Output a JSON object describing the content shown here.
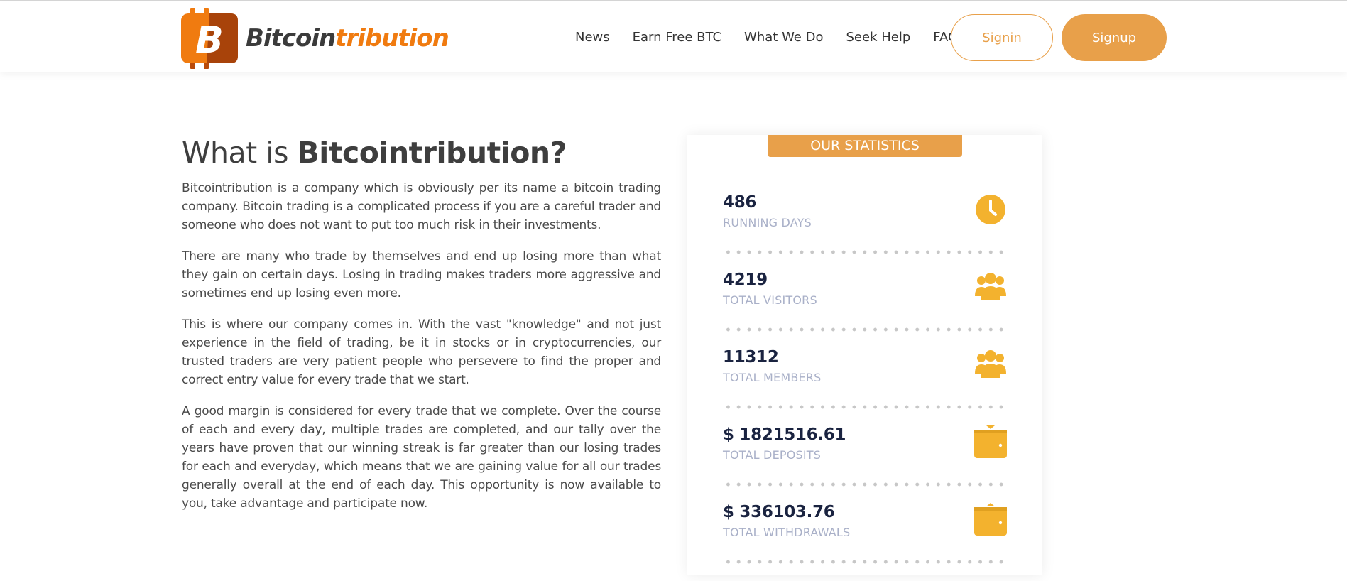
{
  "brand": {
    "name_dark": "Bitcoin",
    "name_orange": "tribution",
    "logo_letter": "B",
    "colors": {
      "accent": "#e8a04a",
      "logo_orange": "#f07b10",
      "icon_yellow": "#f3b22e",
      "heading": "#3e3e3e"
    }
  },
  "nav": {
    "items": [
      "News",
      "Earn Free BTC",
      "What We Do",
      "Seek Help",
      "FAQ"
    ],
    "signin_label": "Signin",
    "signup_label": "Signup"
  },
  "about": {
    "title_prefix": "What is ",
    "title_bold": "Bitcointribution?",
    "paragraphs": [
      "Bitcointribution is a company which is obviously per its name a bitcoin trading company. Bitcoin trading is a complicated process if you are a careful trader and someone who does not want to put too much risk in their investments.",
      "There are many who trade by themselves and end up losing more than what they gain on certain days. Losing in trading makes traders more aggressive and sometimes end up losing even more.",
      "This is where our company comes in. With the vast \"knowledge\" and not just experience in the field of trading, be it in stocks or in cryptocurrencies, our trusted traders are very patient people who persevere to find the proper and correct entry value for every trade that we start.",
      "A good margin is considered for every trade that we complete. Over the course of each and every day, multiple trades are completed, and our tally over the years have proven that our winning streak is far greater than our losing trades for each and everyday, which means that we are gaining value for all our trades generally overall at the end of each day. This opportunity is now available to you, take advantage and participate now."
    ]
  },
  "stats": {
    "heading": "OUR STATISTICS",
    "items": [
      {
        "value": "486",
        "label": "RUNNING DAYS",
        "icon": "clock-icon"
      },
      {
        "value": "4219",
        "label": "TOTAL VISITORS",
        "icon": "users-icon"
      },
      {
        "value": "11312",
        "label": "TOTAL MEMBERS",
        "icon": "users-icon"
      },
      {
        "value": "$ 1821516.61",
        "label": "TOTAL DEPOSITS",
        "icon": "wallet-deposit-icon"
      },
      {
        "value": "$ 336103.76",
        "label": "TOTAL WITHDRAWALS",
        "icon": "wallet-withdraw-icon"
      }
    ]
  }
}
